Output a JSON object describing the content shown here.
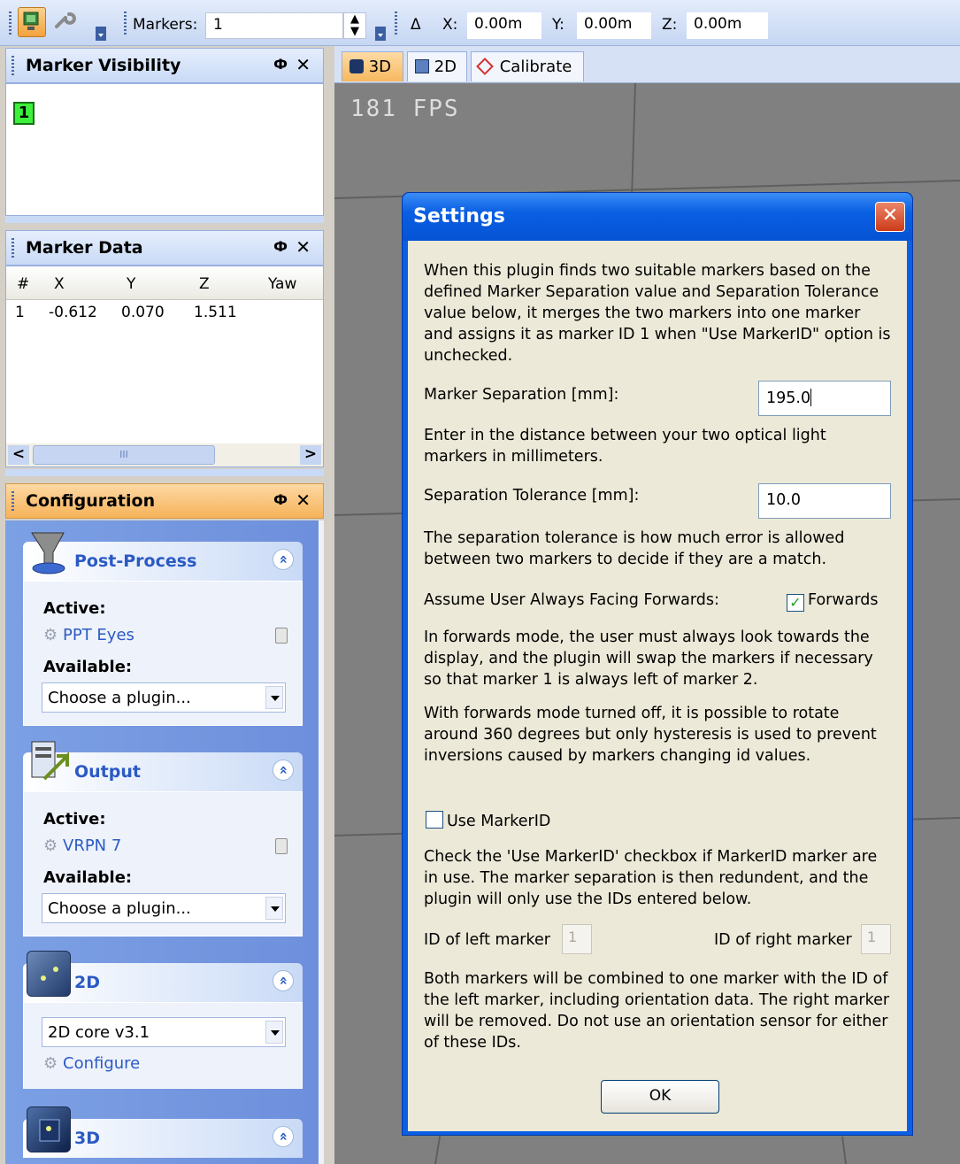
{
  "toolbar": {
    "markers_label": "Markers:",
    "markers_value": "1",
    "delta_symbol": "Δ",
    "x_label": "X:",
    "x_value": "0.00m",
    "y_label": "Y:",
    "y_value": "0.00m",
    "z_label": "Z:",
    "z_value": "0.00m"
  },
  "marker_visibility": {
    "title": "Marker Visibility",
    "pin": "Ф",
    "close": "✕",
    "marker": "1"
  },
  "marker_data": {
    "title": "Marker Data",
    "pin": "Ф",
    "close": "✕",
    "columns": [
      "#",
      "X",
      "Y",
      "Z",
      "Yaw"
    ],
    "rows": [
      [
        "1",
        "-0.612",
        "0.070",
        "1.511",
        ""
      ]
    ],
    "scroll_left": "<",
    "scroll_right": ">",
    "scroll_grip": "III"
  },
  "configuration": {
    "title": "Configuration",
    "pin": "Ф",
    "close": "✕",
    "chevron": "»",
    "post_process": {
      "title": "Post-Process",
      "active_label": "Active:",
      "active_item": "PPT Eyes",
      "available_label": "Available:",
      "select_value": "Choose a plugin..."
    },
    "output": {
      "title": "Output",
      "active_label": "Active:",
      "active_item": "VRPN 7",
      "available_label": "Available:",
      "select_value": "Choose a plugin..."
    },
    "two_d": {
      "title": "2D",
      "select_value": "2D core v3.1",
      "configure_label": "Configure"
    },
    "three_d": {
      "title": "3D"
    }
  },
  "tabs": [
    "3D",
    "2D",
    "Calibrate"
  ],
  "viewport": {
    "fps": "181 FPS"
  },
  "dialog": {
    "title": "Settings",
    "close": "✕",
    "intro": "When this plugin finds two suitable markers based on the defined Marker Separation value and Separation Tolerance value below, it merges the two markers into one marker and assigns it as marker ID 1 when \"Use MarkerID\" option is unchecked.",
    "separation_label": "Marker Separation [mm]:",
    "separation_value": "195.0",
    "separation_help": "Enter in the distance between your two optical light markers in millimeters.",
    "tolerance_label": "Separation Tolerance [mm]:",
    "tolerance_value": "10.0",
    "tolerance_help": "The separation tolerance is how much error is allowed between two markers to decide if they are a match.",
    "forwards_label": "Assume User Always Facing Forwards:",
    "forwards_checkbox_label": "Forwards",
    "forwards_checked": "✓",
    "forwards_help": "In forwards mode, the user must always look towards the display, and the plugin will swap the markers if necessary so that marker 1 is always left of marker 2.",
    "forwards_off_help": "With forwards mode turned off, it is possible to rotate around 360 degrees but only hysteresis is used to prevent inversions caused by markers changing id values.",
    "use_markerid_label": "Use MarkerID",
    "use_markerid_help": "Check the 'Use MarkerID' checkbox if MarkerID marker are in use. The marker separation is then redundent, and the plugin will only use the IDs entered below.",
    "left_id_label": "ID of left marker",
    "left_id_value": "1",
    "right_id_label": "ID of right marker",
    "right_id_value": "1",
    "combine_help": "Both markers will be combined to one marker with the ID of the left marker, including orientation data. The right marker will be removed. Do not use an orientation sensor for either of these IDs.",
    "ok_label": "OK"
  }
}
